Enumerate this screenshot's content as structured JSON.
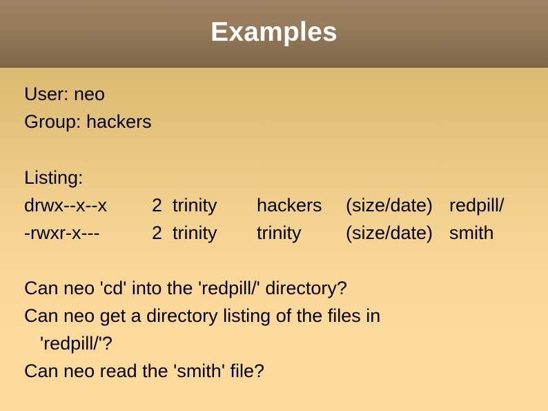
{
  "slide": {
    "title": "Examples",
    "colors": {
      "header_top": "#9c8262",
      "header_bottom": "#7e6747",
      "body_top": "#dcba70",
      "body_bottom": "#fcdb9d",
      "title_text": "#ffffff",
      "body_text": "#000000"
    },
    "identity": {
      "user_line": "User: neo",
      "group_line": "Group: hackers"
    },
    "listing": {
      "heading": "Listing:",
      "rows": [
        {
          "permissions": "drwx--x--x",
          "links": "2",
          "owner": "trinity",
          "group": "hackers",
          "size_date": "(size/date)",
          "name": "redpill/"
        },
        {
          "permissions": "-rwxr-x---",
          "links": "2",
          "owner": "trinity",
          "group": "trinity",
          "size_date": "(size/date)",
          "name": "smith"
        }
      ]
    },
    "questions": [
      {
        "text": "Can neo 'cd' into the 'redpill/' directory?",
        "indented": false
      },
      {
        "text": "Can neo get a directory listing of the files in",
        "indented": false
      },
      {
        "text": "'redpill/'?",
        "indented": true
      },
      {
        "text": "Can neo read the 'smith' file?",
        "indented": false
      }
    ]
  }
}
